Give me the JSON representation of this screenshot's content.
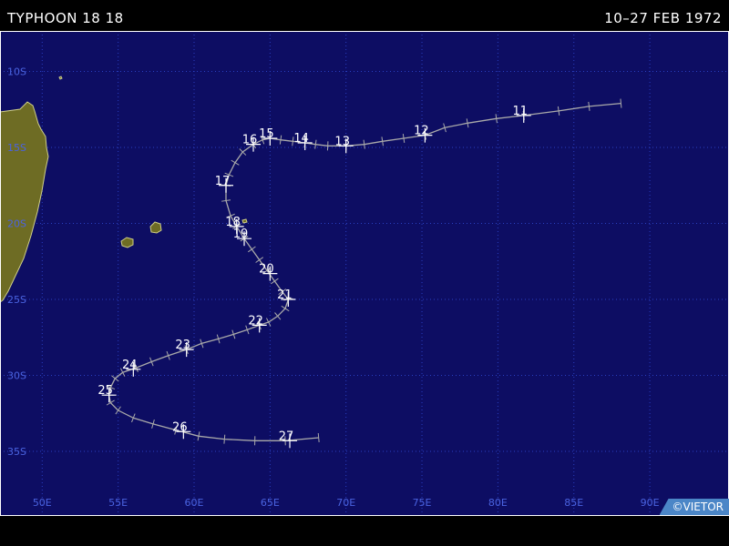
{
  "header": {
    "title": "TYPHOON 18 18",
    "date_range": "10–27 FEB 1972"
  },
  "credit": "©VIETOR",
  "colors": {
    "ocean": "#0d0d63",
    "grid": "#2a3fc0",
    "land": "#6e6c24",
    "land_border": "#cfcf88",
    "track": "#a9a9a9",
    "label": "#ffffff",
    "axis_label": "#4a63e0"
  },
  "map": {
    "lon_range": [
      48,
      93
    ],
    "lat_range": [
      -39,
      -7
    ],
    "lat_labels": [
      {
        "lat": -10,
        "text": "10S"
      },
      {
        "lat": -15,
        "text": "15S"
      },
      {
        "lat": -20,
        "text": "20S"
      },
      {
        "lat": -25,
        "text": "25S"
      },
      {
        "lat": -30,
        "text": "30S"
      },
      {
        "lat": -35,
        "text": "35S"
      }
    ],
    "lon_labels": [
      {
        "lon": 50,
        "text": "50E"
      },
      {
        "lon": 55,
        "text": "55E"
      },
      {
        "lon": 60,
        "text": "60E"
      },
      {
        "lon": 65,
        "text": "65E"
      },
      {
        "lon": 70,
        "text": "70E"
      },
      {
        "lon": 75,
        "text": "75E"
      },
      {
        "lon": 80,
        "text": "80E"
      },
      {
        "lon": 85,
        "text": "85E"
      },
      {
        "lon": 90,
        "text": "90E"
      }
    ],
    "track": [
      [
        88.1,
        -12.1
      ],
      [
        86.0,
        -12.3
      ],
      [
        84.0,
        -12.6
      ],
      [
        81.7,
        -12.9
      ],
      [
        79.9,
        -13.1
      ],
      [
        78.0,
        -13.4
      ],
      [
        76.5,
        -13.7
      ],
      [
        75.2,
        -14.2
      ],
      [
        73.8,
        -14.4
      ],
      [
        72.4,
        -14.6
      ],
      [
        71.2,
        -14.8
      ],
      [
        70.0,
        -14.9
      ],
      [
        68.8,
        -14.9
      ],
      [
        68.0,
        -14.8
      ],
      [
        67.3,
        -14.7
      ],
      [
        66.5,
        -14.6
      ],
      [
        65.7,
        -14.5
      ],
      [
        65.0,
        -14.4
      ],
      [
        64.5,
        -14.5
      ],
      [
        63.9,
        -14.8
      ],
      [
        63.2,
        -15.3
      ],
      [
        62.7,
        -16.0
      ],
      [
        62.3,
        -16.8
      ],
      [
        62.1,
        -17.5
      ],
      [
        62.1,
        -18.5
      ],
      [
        62.4,
        -19.5
      ],
      [
        62.8,
        -20.2
      ],
      [
        63.3,
        -21.0
      ],
      [
        63.8,
        -21.7
      ],
      [
        64.3,
        -22.4
      ],
      [
        64.8,
        -23.1
      ],
      [
        65.3,
        -23.8
      ],
      [
        65.8,
        -24.5
      ],
      [
        66.2,
        -25.0
      ],
      [
        66.0,
        -25.6
      ],
      [
        65.5,
        -26.1
      ],
      [
        64.9,
        -26.5
      ],
      [
        64.3,
        -26.7
      ],
      [
        63.5,
        -27.0
      ],
      [
        62.6,
        -27.3
      ],
      [
        61.6,
        -27.6
      ],
      [
        60.5,
        -27.9
      ],
      [
        59.5,
        -28.3
      ],
      [
        58.3,
        -28.7
      ],
      [
        57.2,
        -29.1
      ],
      [
        56.2,
        -29.5
      ],
      [
        55.3,
        -29.8
      ],
      [
        54.8,
        -30.2
      ],
      [
        54.5,
        -30.8
      ],
      [
        54.4,
        -31.3
      ],
      [
        54.5,
        -31.8
      ],
      [
        55.0,
        -32.3
      ],
      [
        56.0,
        -32.8
      ],
      [
        57.3,
        -33.2
      ],
      [
        58.8,
        -33.6
      ],
      [
        60.3,
        -34.0
      ],
      [
        62.0,
        -34.2
      ],
      [
        64.0,
        -34.3
      ],
      [
        66.0,
        -34.3
      ],
      [
        68.2,
        -34.1
      ]
    ],
    "day_markers": [
      {
        "day": "11",
        "lon": 81.7,
        "lat": -12.9
      },
      {
        "day": "12",
        "lon": 75.2,
        "lat": -14.2
      },
      {
        "day": "13",
        "lon": 70.0,
        "lat": -14.9
      },
      {
        "day": "14",
        "lon": 67.3,
        "lat": -14.7
      },
      {
        "day": "15",
        "lon": 65.0,
        "lat": -14.4
      },
      {
        "day": "16",
        "lon": 63.9,
        "lat": -14.8
      },
      {
        "day": "17",
        "lon": 62.1,
        "lat": -17.5
      },
      {
        "day": "18",
        "lon": 62.8,
        "lat": -20.2
      },
      {
        "day": "19",
        "lon": 63.3,
        "lat": -21.0
      },
      {
        "day": "20",
        "lon": 65.0,
        "lat": -23.3
      },
      {
        "day": "21",
        "lon": 66.2,
        "lat": -25.0
      },
      {
        "day": "22",
        "lon": 64.3,
        "lat": -26.7
      },
      {
        "day": "23",
        "lon": 59.5,
        "lat": -28.3
      },
      {
        "day": "24",
        "lon": 56.0,
        "lat": -29.6
      },
      {
        "day": "25",
        "lon": 54.4,
        "lat": -31.3
      },
      {
        "day": "26",
        "lon": 59.3,
        "lat": -33.7
      },
      {
        "day": "27",
        "lon": 66.3,
        "lat": -34.3
      }
    ]
  }
}
